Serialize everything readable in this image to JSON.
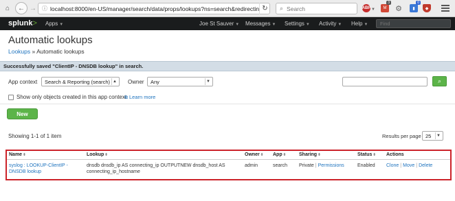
{
  "browser": {
    "url": "localhost:8000/en-US/manager/search/data/props/lookups?ns=search&redirectin",
    "search_placeholder": "Search",
    "gmail_badge": "3",
    "ext_badge": "0"
  },
  "splunkbar": {
    "logo_main": "splunk",
    "logo_suffix": ">",
    "items": {
      "apps": "Apps",
      "user": "Joe St Sauver",
      "messages": "Messages",
      "settings": "Settings",
      "activity": "Activity",
      "help": "Help"
    },
    "find_placeholder": "Find"
  },
  "page": {
    "title": "Automatic lookups",
    "breadcrumb_link": "Lookups",
    "breadcrumb_sep": " » ",
    "breadcrumb_current": "Automatic lookups"
  },
  "message": "Successfully saved \"ClientIP - DNSDB lookup\" in search.",
  "filters": {
    "app_context_label": "App context",
    "app_context_value": "Search & Reporting (search)",
    "owner_label": "Owner",
    "owner_value": "Any",
    "checkbox_label": "Show only objects created in this app context",
    "learn_more": "Learn more"
  },
  "new_button": "New",
  "showing": "Showing 1-1 of 1 item",
  "results_per_page_label": "Results per page",
  "results_per_page_value": "25",
  "table": {
    "headers": {
      "name": "Name",
      "lookup": "Lookup",
      "owner": "Owner",
      "app": "App",
      "sharing": "Sharing",
      "status": "Status",
      "actions": "Actions"
    },
    "row": {
      "name_line1": "syslog : LOOKUP-ClientIP -",
      "name_line2": "DNSDB lookup",
      "lookup_line1": "dnsdb dnsdb_ip AS connecting_ip OUTPUTNEW dnsdb_host AS",
      "lookup_line2": "connecting_ip_hostname",
      "owner": "admin",
      "app": "search",
      "sharing": "Private",
      "permissions": "Permissions",
      "status": "Enabled",
      "clone": "Clone",
      "move": "Move",
      "delete": "Delete"
    }
  },
  "colors": {
    "accent_green": "#5cb449",
    "highlight_red": "#cc2229",
    "link_blue": "#1e73be",
    "splunkbar_bg": "#1a1c1d",
    "message_bg": "#d3dde6"
  },
  "icons": {
    "home": "home-icon",
    "back": "back-arrow-icon",
    "forward": "forward-arrow-icon",
    "reload": "reload-icon",
    "search": "magnifier-icon",
    "menu": "hamburger-menu-icon"
  }
}
